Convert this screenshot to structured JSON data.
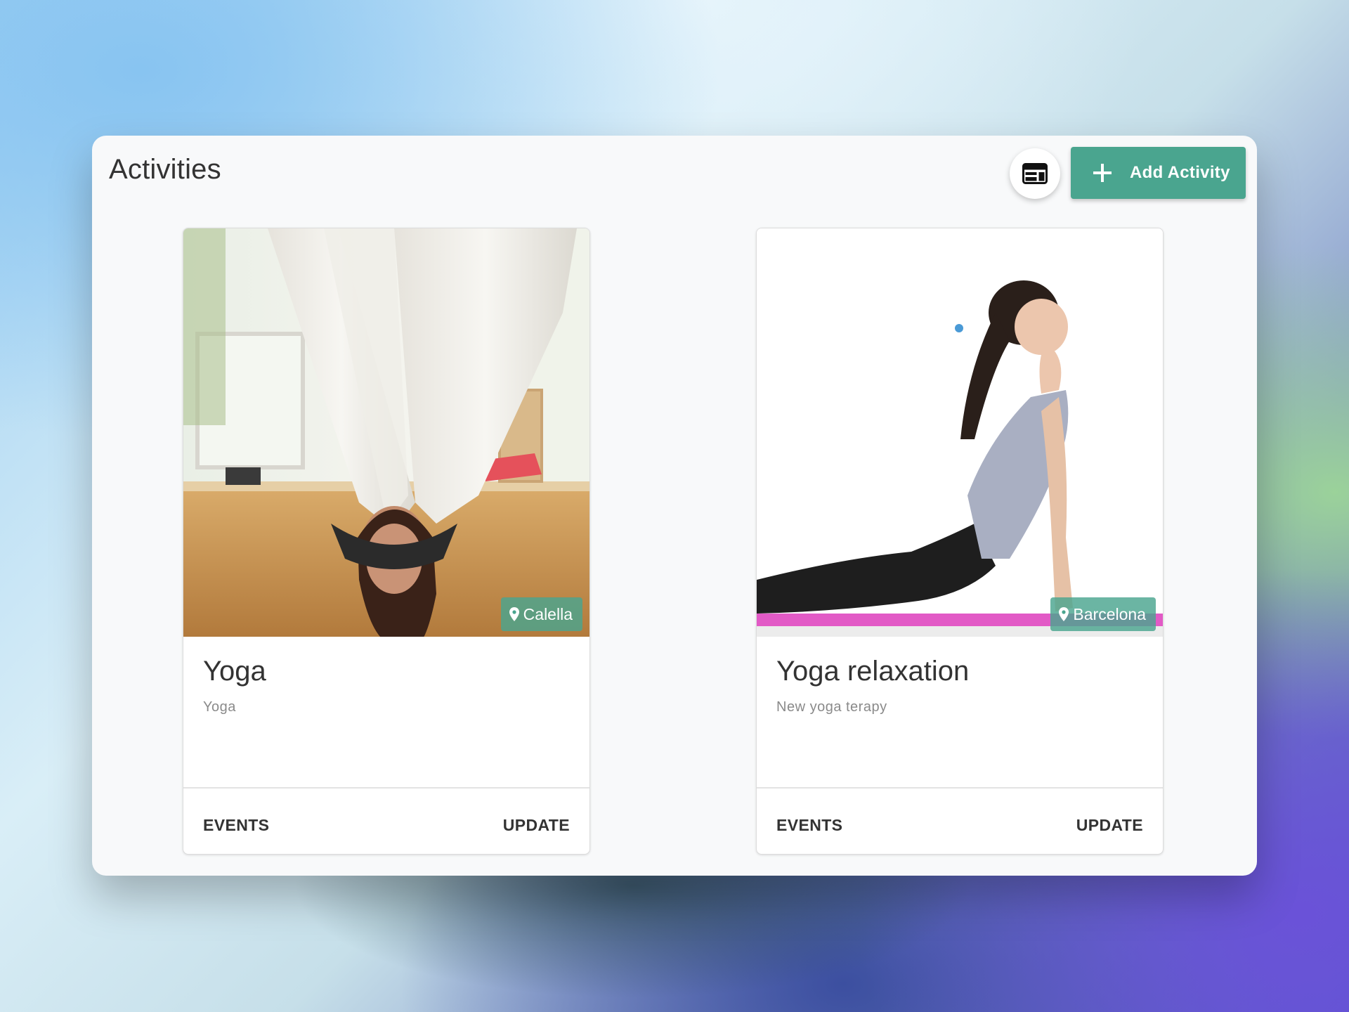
{
  "page": {
    "title": "Activities"
  },
  "toolbar": {
    "layout_toggle_icon": "view-quilt-icon",
    "add_button_label": "Add Activity",
    "add_button_icon": "plus-icon",
    "accent_color": "#4aa58f"
  },
  "activities": [
    {
      "title": "Yoga",
      "subtitle": "Yoga",
      "location": "Calella",
      "location_icon": "map-pin-icon",
      "image": "aerial-yoga-photo",
      "actions": {
        "events": "EVENTS",
        "update": "UPDATE"
      }
    },
    {
      "title": "Yoga relaxation",
      "subtitle": "New yoga terapy",
      "location": "Barcelona",
      "location_icon": "map-pin-icon",
      "image": "cobra-pose-photo",
      "actions": {
        "events": "EVENTS",
        "update": "UPDATE"
      }
    }
  ]
}
